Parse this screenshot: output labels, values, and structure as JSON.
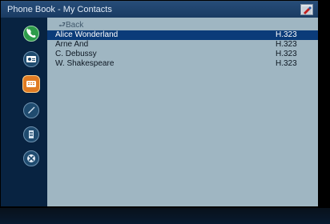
{
  "window": {
    "title": "Phone Book - My Contacts"
  },
  "sidebar": {
    "items": [
      {
        "name": "phone-icon",
        "color": "#2d9c4a"
      },
      {
        "name": "contact-card-icon",
        "color": "#1f4b6f"
      },
      {
        "name": "phonebook-icon",
        "color": "#e07b23"
      },
      {
        "name": "edit-icon",
        "color": "#1f4b6f"
      },
      {
        "name": "document-icon",
        "color": "#1f4b6f"
      },
      {
        "name": "close-icon",
        "color": "#1f4b6f"
      }
    ]
  },
  "list": {
    "back_label": "⮐Back",
    "items": [
      {
        "name": "Alice Wonderland",
        "protocol": "H.323",
        "selected": true
      },
      {
        "name": "Arne And",
        "protocol": "H.323",
        "selected": false
      },
      {
        "name": "C. Debussy",
        "protocol": "H.323",
        "selected": false
      },
      {
        "name": "W. Shakespeare",
        "protocol": "H.323",
        "selected": false
      }
    ]
  }
}
